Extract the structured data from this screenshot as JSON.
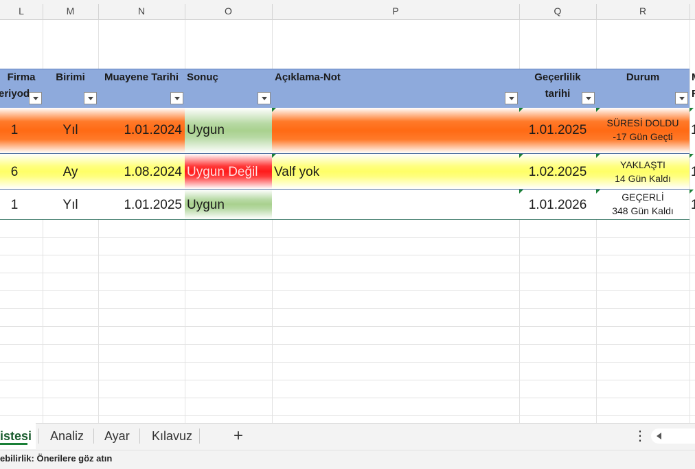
{
  "columns": [
    "L",
    "M",
    "N",
    "O",
    "P",
    "Q",
    "R"
  ],
  "headers": {
    "firma_1": "Firma",
    "firma_2": "eriyod",
    "birimi": "Birimi",
    "muayene": "Muayene Tarihi",
    "sonuc": "Sonuç",
    "aciklama": "Açıklama-Not",
    "gecerlilik_1": "Geçerlilik",
    "gecerlilik_2": "tarihi",
    "durum": "Durum",
    "extra_1": "M",
    "extra_2": "F"
  },
  "rows": [
    {
      "period": "1",
      "unit": "Yıl",
      "date": "1.01.2024",
      "result": "Uygun",
      "note": "",
      "valid": "1.01.2025",
      "status1": "SÜRESİ DOLDU",
      "status2": "-17 Gün Geçti",
      "extra": "1"
    },
    {
      "period": "6",
      "unit": "Ay",
      "date": "1.08.2024",
      "result": "Uygun Değil",
      "note": "Valf yok",
      "valid": "1.02.2025",
      "status1": "YAKLAŞTI",
      "status2": "14 Gün Kaldı",
      "extra": "1"
    },
    {
      "period": "1",
      "unit": "Yıl",
      "date": "1.01.2025",
      "result": "Uygun",
      "note": "",
      "valid": "1.01.2026",
      "status1": "GEÇERLİ",
      "status2": "348 Gün Kaldı",
      "extra": "1"
    }
  ],
  "sheet_tabs": [
    "istesi",
    "Analiz",
    "Ayar",
    "Kılavuz"
  ],
  "add_sheet": "+",
  "more_menu": "⋮",
  "status_text": "ebilirlik: Önerilere göz atın",
  "colors": {
    "header_blue": "#8eaadc",
    "expired_orange": "#ff6a14",
    "warning_yellow": "#ffff66",
    "fail_red": "#ff1a1a",
    "pass_green": "#a9d18e"
  }
}
